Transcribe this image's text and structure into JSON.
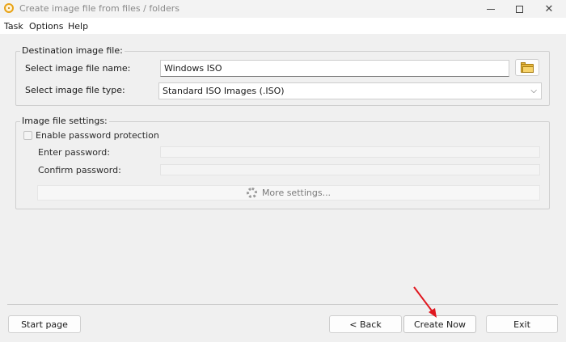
{
  "window": {
    "title": "Create image file from files / folders",
    "controls": {
      "minimize": "—",
      "maximize": "",
      "close": "✕"
    }
  },
  "menu": {
    "items": [
      "Task",
      "Options",
      "Help"
    ]
  },
  "destination": {
    "group_label": "Destination image file:",
    "name_label": "Select image file name:",
    "name_value": "Windows ISO",
    "type_label": "Select image file type:",
    "type_value": "Standard ISO Images (.ISO)"
  },
  "settings": {
    "group_label": "Image file settings:",
    "password_checkbox_label": "Enable password protection",
    "password_checked": false,
    "enter_password_label": "Enter password:",
    "enter_password_value": "",
    "confirm_password_label": "Confirm password:",
    "confirm_password_value": "",
    "more_settings_label": "More settings..."
  },
  "footer": {
    "start_page": "Start page",
    "back": "< Back",
    "create_now": "Create Now",
    "exit": "Exit"
  },
  "colors": {
    "annotation_arrow": "#e0171f",
    "background": "#f0f0f0"
  },
  "icons": [
    "app-disc-icon",
    "folder-icon",
    "gear-icon",
    "chevron-down-icon",
    "minimize-icon",
    "maximize-icon",
    "close-icon"
  ]
}
